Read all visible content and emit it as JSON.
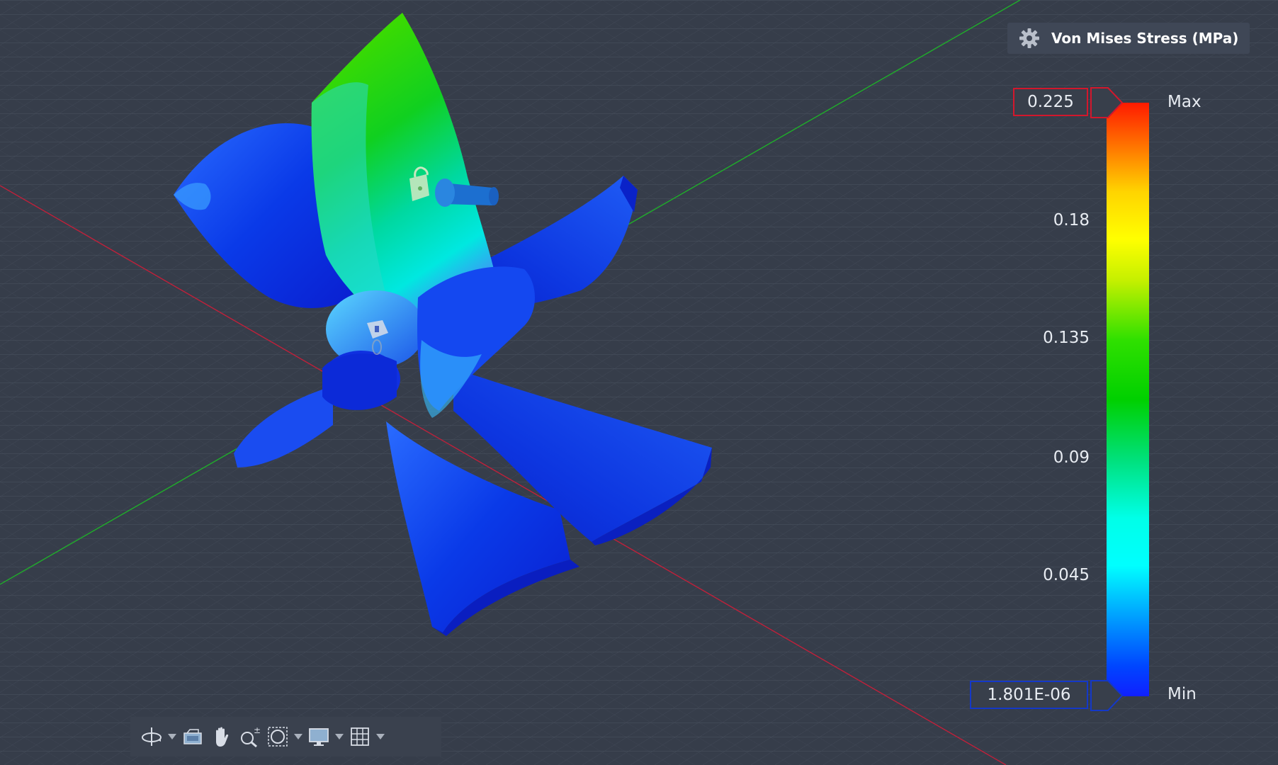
{
  "legend": {
    "title": "Von Mises Stress (MPa)",
    "max_value": "0.225",
    "min_value": "1.801E-06",
    "max_label": "Max",
    "min_label": "Min",
    "ticks": [
      "0.18",
      "0.135",
      "0.09",
      "0.045"
    ]
  },
  "colors": {
    "background": "#363d4a",
    "grid_line": "#4a5260",
    "x_axis": "#c0203a",
    "y_axis": "#1fae2a",
    "max_border": "#d3172c",
    "min_border": "#1438c8"
  },
  "toolbar": {
    "tools": [
      {
        "icon": "orbit-icon",
        "has_dropdown": true
      },
      {
        "icon": "look-at-icon",
        "has_dropdown": false
      },
      {
        "icon": "pan-hand-icon",
        "has_dropdown": false
      },
      {
        "icon": "zoom-icon",
        "has_dropdown": false
      },
      {
        "icon": "fit-window-icon",
        "has_dropdown": true
      },
      {
        "icon": "display-settings-icon",
        "has_dropdown": true
      },
      {
        "icon": "grid-icon",
        "has_dropdown": true
      }
    ]
  }
}
